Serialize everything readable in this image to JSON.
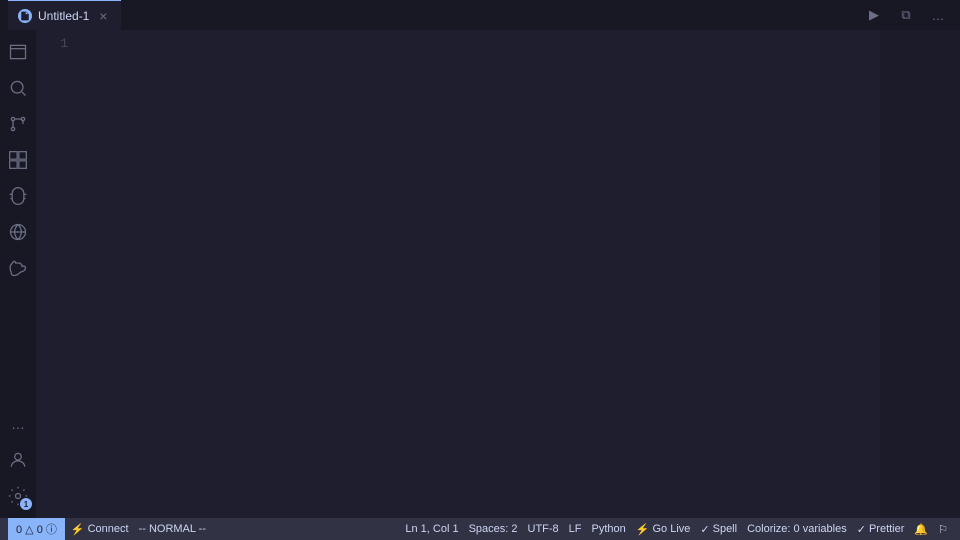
{
  "titlebar": {
    "tab": {
      "label": "Untitled-1",
      "close_label": "×"
    },
    "actions": {
      "run_label": "▶",
      "split_label": "⧉",
      "more_label": "…"
    }
  },
  "activity_bar": {
    "items": [
      {
        "name": "explorer",
        "icon": "files",
        "active": false
      },
      {
        "name": "search",
        "icon": "search",
        "active": false
      },
      {
        "name": "source-control",
        "icon": "git",
        "active": false
      },
      {
        "name": "extensions",
        "icon": "extensions",
        "active": false
      },
      {
        "name": "run-debug",
        "icon": "debug",
        "active": false
      },
      {
        "name": "remote-explorer",
        "icon": "remote",
        "active": false
      },
      {
        "name": "docker",
        "icon": "docker",
        "active": false
      }
    ],
    "bottom_items": [
      {
        "name": "accounts",
        "icon": "person"
      },
      {
        "name": "settings",
        "icon": "gear",
        "badge": "1"
      }
    ],
    "more": {
      "label": "…"
    }
  },
  "editor": {
    "line_number": "1",
    "content": ""
  },
  "status_bar": {
    "git_branch": "0 △ 0 ⓘ",
    "connect": "Connect",
    "vim_mode": "-- NORMAL --",
    "position": "Ln 1, Col 1",
    "spaces": "Spaces: 2",
    "encoding": "UTF-8",
    "eol": "LF",
    "language": "Python",
    "go_live": "Go Live",
    "spell": "Spell",
    "colorize": "Colorize: 0 variables",
    "prettier": "Prettier",
    "bell_icon": "🔔",
    "notif_icon": "🔔"
  }
}
